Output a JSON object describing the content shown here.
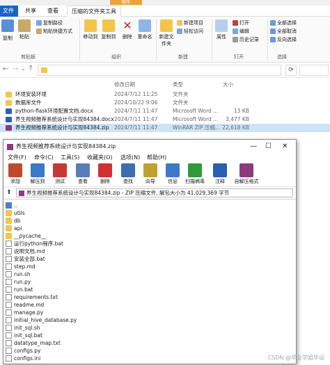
{
  "explorer": {
    "extract_tab": "解压",
    "tabs": {
      "file": "文件",
      "share": "共享",
      "view": "查看",
      "tools": "压缩的文件夹工具"
    },
    "ribbon": {
      "pin": "固定到快速访问",
      "copy": "复制",
      "paste": "粘贴",
      "copy_path": "复制路径",
      "paste_shortcut": "粘贴快捷方式",
      "clipboard_group": "剪贴板",
      "move_to": "移动到",
      "copy_to": "复制到",
      "delete": "删除",
      "rename": "重命名",
      "organize_group": "组织",
      "new_item": "新建项目",
      "easy_access": "轻松访问",
      "new_folder": "新建文件夹",
      "new_group": "新建",
      "properties": "属性",
      "open": "打开",
      "edit": "编辑",
      "history": "历史记录",
      "open_group": "打开",
      "select_all": "全部选择",
      "select_none": "全部取消",
      "invert": "反向选择",
      "select_group": "选择"
    },
    "columns": {
      "date": "修改日期",
      "type": "类型",
      "size": "大小"
    },
    "files": [
      {
        "name": "环境安装环境",
        "date": "2024/7/12 11:25",
        "type": "文件夹",
        "size": "",
        "kind": "folder"
      },
      {
        "name": "数据库文件",
        "date": "2024/10/22 9:06",
        "type": "文件夹",
        "size": "",
        "kind": "folder"
      },
      {
        "name": "python-flask环境配置文档.docx",
        "date": "2024/7/11 11:47",
        "type": "Microsoft Word ...",
        "size": "13 KB",
        "kind": "word"
      },
      {
        "name": "养生视频推荐系统设计与实现84384.docx",
        "date": "2024/7/11 11:47",
        "type": "Microsoft Word ...",
        "size": "3,477 KB",
        "kind": "word"
      },
      {
        "name": "养生视频推荐系统设计与实现84384.zip",
        "date": "2024/7/11 11:47",
        "type": "WinRAR ZIP 压缩...",
        "size": "22,618 KB",
        "kind": "zip"
      }
    ]
  },
  "rar": {
    "title": "养生视频推荐系统设计与实现84384.zip",
    "menu": [
      "文件(F)",
      "命令(C)",
      "工具(S)",
      "收藏夹(O)",
      "选项(N)",
      "帮助(H)"
    ],
    "tools": [
      "添加",
      "解压到",
      "测试",
      "查看",
      "删除",
      "查找",
      "向导",
      "信息",
      "扫描病毒",
      "注释",
      "自解压格式"
    ],
    "path": "养生视频推荐系统设计与实现84384.zip - ZIP 压缩文件, 解包大小为 41,029,369 字节",
    "items": [
      {
        "name": "..",
        "kind": "up"
      },
      {
        "name": "utils",
        "kind": "folder"
      },
      {
        "name": "db",
        "kind": "folder"
      },
      {
        "name": "api",
        "kind": "folder"
      },
      {
        "name": "__pycache__",
        "kind": "folder"
      },
      {
        "name": "运行python程序.bat",
        "kind": "file"
      },
      {
        "name": "说明文档.md",
        "kind": "file"
      },
      {
        "name": "安装全部.bat",
        "kind": "file"
      },
      {
        "name": "step.md",
        "kind": "file"
      },
      {
        "name": "run.sh",
        "kind": "file"
      },
      {
        "name": "run.py",
        "kind": "file"
      },
      {
        "name": "run.bat",
        "kind": "file"
      },
      {
        "name": "requirements.txt",
        "kind": "file"
      },
      {
        "name": "readme.md",
        "kind": "file"
      },
      {
        "name": "manage.py",
        "kind": "file"
      },
      {
        "name": "initial_hive_database.py",
        "kind": "file"
      },
      {
        "name": "init_sql.sh",
        "kind": "file"
      },
      {
        "name": "init_sql.bat",
        "kind": "file"
      },
      {
        "name": "datatype_map.txt",
        "kind": "file"
      },
      {
        "name": "configs.py",
        "kind": "file"
      },
      {
        "name": "configs.ini",
        "kind": "file"
      }
    ]
  },
  "watermark": "CSDN @毕业学姐毕设",
  "colors": {
    "accent": "#1a64c6",
    "selected": "#cce4f7",
    "folder": "#f3c549",
    "extract": "#e8a33c"
  }
}
